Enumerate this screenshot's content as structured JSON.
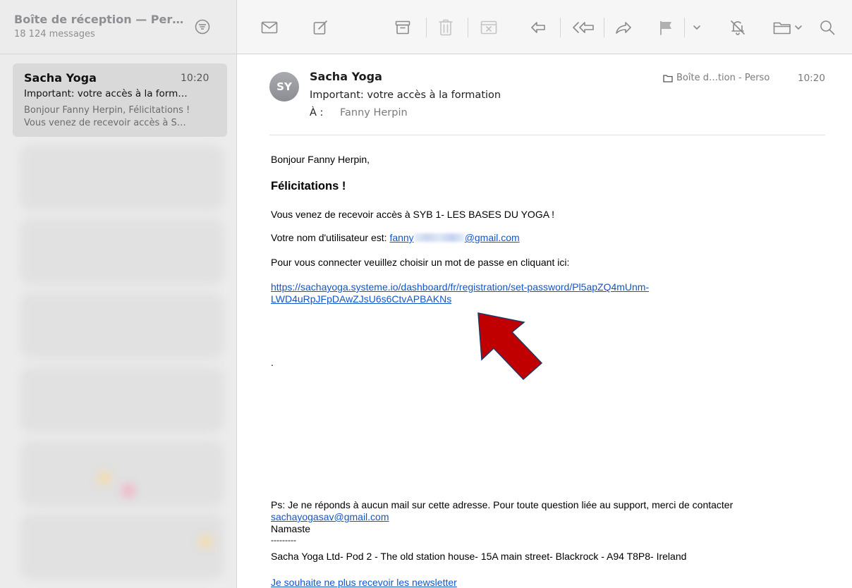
{
  "sidebar": {
    "mailbox_title": "Boîte de réception — Per…",
    "message_count": "18 124 messages",
    "selected": {
      "sender": "Sacha Yoga",
      "time": "10:20",
      "subject": "Important: votre accès à la form…",
      "preview_line1": "Bonjour Fanny Herpin, Félicitations !",
      "preview_line2": "Vous venez de recevoir accès à S…"
    }
  },
  "toolbar": {
    "icons": [
      "envelope-icon",
      "compose-icon",
      "archive-icon",
      "trash-icon",
      "junk-icon",
      "reply-icon",
      "reply-all-icon",
      "forward-icon",
      "flag-icon",
      "mute-icon",
      "move-to-folder-icon",
      "search-icon"
    ]
  },
  "message": {
    "avatar_initials": "SY",
    "sender": "Sacha Yoga",
    "subject": "Important: votre accès à la formation",
    "to_label": "À :",
    "to": "Fanny Herpin",
    "folder": "Boîte d…tion - Perso",
    "time": "10:20",
    "body": {
      "greeting": "Bonjour Fanny Herpin,",
      "heading": "Félicitations !",
      "line1": "Vous venez de recevoir accès à SYB 1- LES BASES DU YOGA !",
      "username_prefix": "Votre nom d'utilisateur est: ",
      "username_link_start": "fanny",
      "username_link_end": "@gmail.com",
      "line3": "Pour vous connecter veuillez choisir un mot de passe en cliquant ici:",
      "link_line1": "https://sachayoga.systeme.io/dashboard/fr/registration/set-password/Pl5apZQ4mUnm-",
      "link_line2": "LWD4uRpJFpDAwZJsU6s6CtvAPBAKNs",
      "dot": ".",
      "ps": "Ps: Je ne réponds à aucun mail sur cette adresse. Pour toute question liée au support, merci de contacter",
      "support_email": "sachayogasav@gmail.com",
      "namaste": "Namaste",
      "dashes": "---------",
      "address": "Sacha Yoga Ltd- Pod 2 - The old station house- 15A main street- Blackrock - A94 T8P8- Ireland",
      "unsubscribe": "Je souhaite ne plus recevoir les newsletter"
    }
  },
  "colors": {
    "link": "#1155cc",
    "arrow": "#c00000",
    "arrow_outline": "#1f3864",
    "avatar": "#9a9ba1"
  }
}
